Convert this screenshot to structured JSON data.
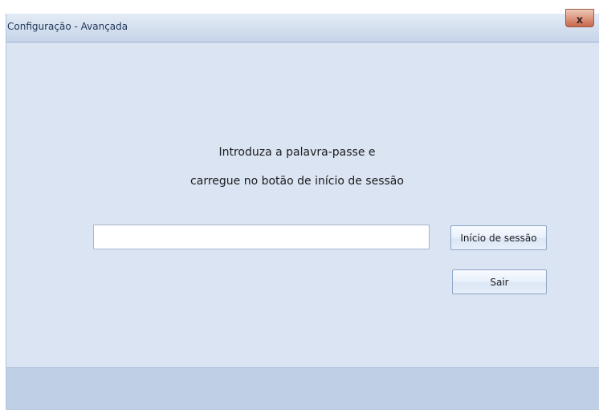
{
  "window": {
    "title": "Configuração - Avançada",
    "close_glyph": "x"
  },
  "message": {
    "line1": "Introduza a palavra-passe e",
    "line2": "carregue no botão de início de sessão"
  },
  "password": {
    "value": "",
    "placeholder": ""
  },
  "buttons": {
    "login_label": "Início de sessão",
    "exit_label": "Sair"
  },
  "colors": {
    "window_background": "#dae4f2",
    "titlebar": "#d4dfee",
    "footer": "#bfcfe6",
    "close_button": "#df9d85"
  }
}
